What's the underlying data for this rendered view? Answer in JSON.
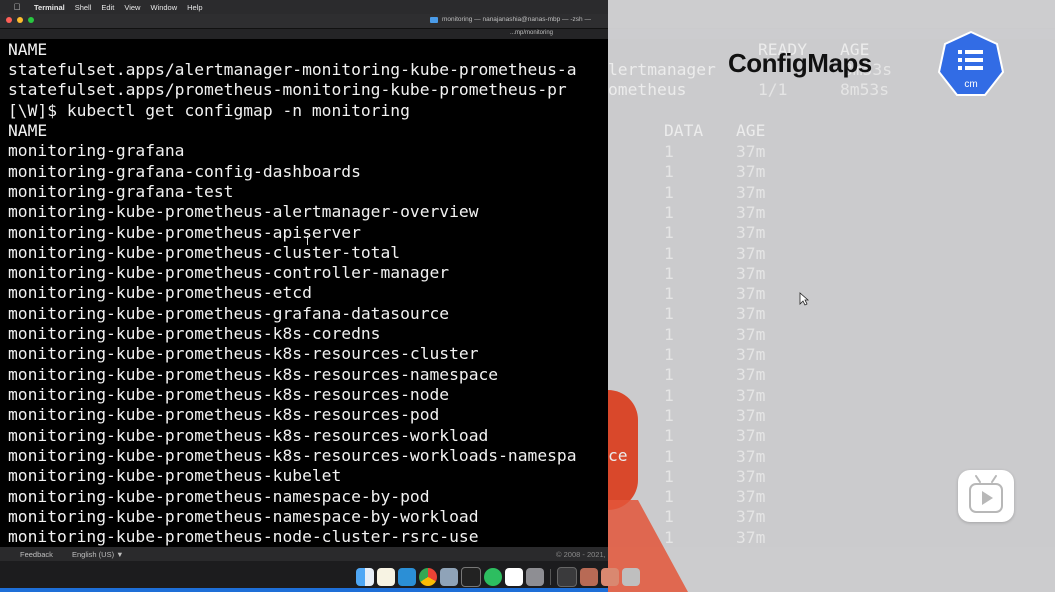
{
  "menubar": {
    "apple": "",
    "app_name": "Terminal",
    "items": [
      "Shell",
      "Edit",
      "View",
      "Window",
      "Help"
    ]
  },
  "window": {
    "title": "monitoring — nanajanashia@nanas-mbp — -zsh —",
    "path": "...mp/monitoring"
  },
  "terminal": {
    "lines": [
      "NAME",
      "statefulset.apps/alertmanager-monitoring-kube-prometheus-a",
      "statefulset.apps/prometheus-monitoring-kube-prometheus-pr",
      "[\\W]$ kubectl get configmap -n monitoring",
      "NAME",
      "monitoring-grafana",
      "monitoring-grafana-config-dashboards",
      "monitoring-grafana-test",
      "monitoring-kube-prometheus-alertmanager-overview",
      "monitoring-kube-prometheus-apiserver",
      "monitoring-kube-prometheus-cluster-total",
      "monitoring-kube-prometheus-controller-manager",
      "monitoring-kube-prometheus-etcd",
      "monitoring-kube-prometheus-grafana-datasource",
      "monitoring-kube-prometheus-k8s-coredns",
      "monitoring-kube-prometheus-k8s-resources-cluster",
      "monitoring-kube-prometheus-k8s-resources-namespace",
      "monitoring-kube-prometheus-k8s-resources-node",
      "monitoring-kube-prometheus-k8s-resources-pod",
      "monitoring-kube-prometheus-k8s-resources-workload",
      "monitoring-kube-prometheus-k8s-resources-workloads-namespa",
      "monitoring-kube-prometheus-kubelet",
      "monitoring-kube-prometheus-namespace-by-pod",
      "monitoring-kube-prometheus-namespace-by-workload",
      "monitoring-kube-prometheus-node-cluster-rsrc-use"
    ],
    "overflow": {
      "header_ready": "READY",
      "header_age": "AGE",
      "row1_tail": "lertmanager",
      "row1_age": "8m53s",
      "row2_tail": "ometheus",
      "row2_ready": "1/1",
      "row2_age": "8m53s",
      "header_data": "DATA",
      "cm_age_header": "AGE",
      "row_tail": "ce",
      "data_value": "1",
      "age_value": "37m"
    }
  },
  "overlay": {
    "title": "ConfigMaps",
    "badge_label": "cm",
    "accent_color": "#326ce5",
    "play_icon": "play-icon"
  },
  "statusbar": {
    "feedback": "Feedback",
    "language": "English (US) ▼",
    "copyright": "© 2008 - 2021,"
  },
  "dock": {
    "icons": [
      "finder-icon",
      "notes-icon",
      "vscode-icon",
      "chrome-icon",
      "preview-icon",
      "terminal-icon",
      "evernote-icon",
      "calendar-icon",
      "system-preferences-icon",
      "activity-monitor-icon",
      "app-icon",
      "app-icon",
      "trash-icon"
    ]
  }
}
